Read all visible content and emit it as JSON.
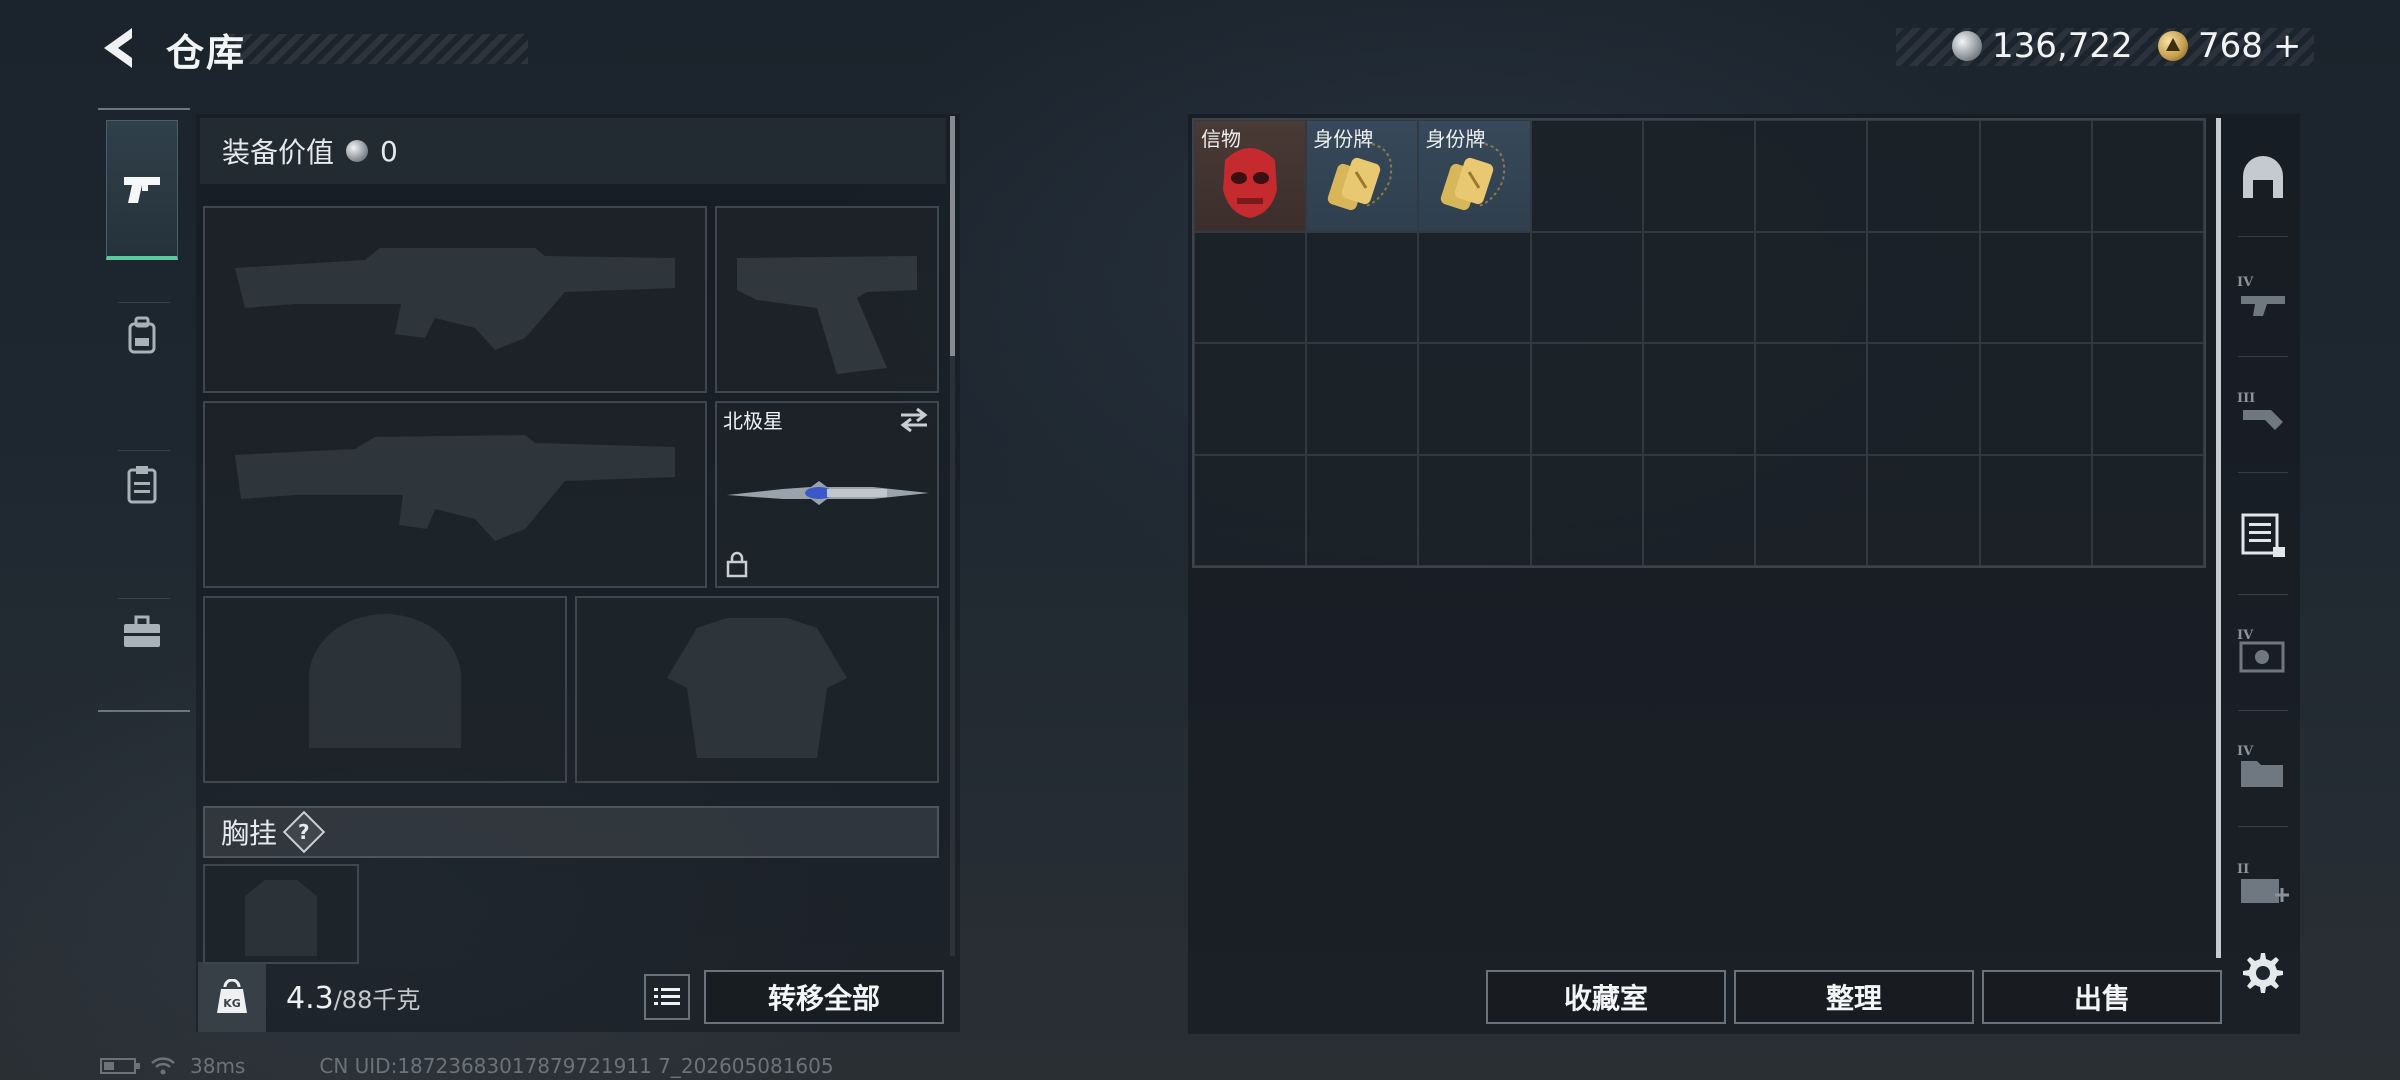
{
  "header": {
    "title": "仓库",
    "currency_silver": "136,722",
    "currency_gold": "768",
    "currency_gold_plus": "+"
  },
  "left_tabs": [
    {
      "name": "weapons",
      "icon": "pistol-icon",
      "active": true
    },
    {
      "name": "backpack",
      "icon": "backpack-icon",
      "active": false
    },
    {
      "name": "clipboard",
      "icon": "clipboard-icon",
      "active": false
    },
    {
      "name": "case",
      "icon": "briefcase-icon",
      "active": false
    }
  ],
  "equipment": {
    "value_label": "装备价值",
    "value": "0",
    "melee_label": "北极星",
    "chest_rig_label": "胸挂",
    "chest_rig_help": "?"
  },
  "footer_left": {
    "weight_icon_text": "KG",
    "weight_value": "4.3",
    "weight_capacity": "/88千克",
    "transfer_all": "转移全部"
  },
  "storage": {
    "items": [
      {
        "label": "信物",
        "icon": "red-skull-mask-icon"
      },
      {
        "label": "身份牌",
        "icon": "gold-dog-tag-icon"
      },
      {
        "label": "身份牌",
        "icon": "gold-dog-tag-icon"
      }
    ],
    "columns": 9,
    "rows": 4
  },
  "right_tabs": [
    {
      "icon": "helmet-shelf-icon",
      "level": ""
    },
    {
      "icon": "gun-rack-iv-icon",
      "level": "IV"
    },
    {
      "icon": "hand-tool-iii-icon",
      "level": "III"
    },
    {
      "icon": "document-stack-icon",
      "level": ""
    },
    {
      "icon": "gear-workshop-iv-icon",
      "level": "IV"
    },
    {
      "icon": "folder-iv-icon",
      "level": "IV"
    },
    {
      "icon": "medkit-ii-icon",
      "level": "II"
    }
  ],
  "footer_right": {
    "collection": "收藏室",
    "sort": "整理",
    "sell": "出售"
  },
  "status_bar": {
    "ping": "38ms",
    "uid": "CN UID:18723683017879721911 7_202605081605"
  },
  "colors": {
    "active_tab_accent": "#5ec8a0",
    "item_red_bg": "#4a3a36",
    "item_blue_bg": "#37495a"
  }
}
